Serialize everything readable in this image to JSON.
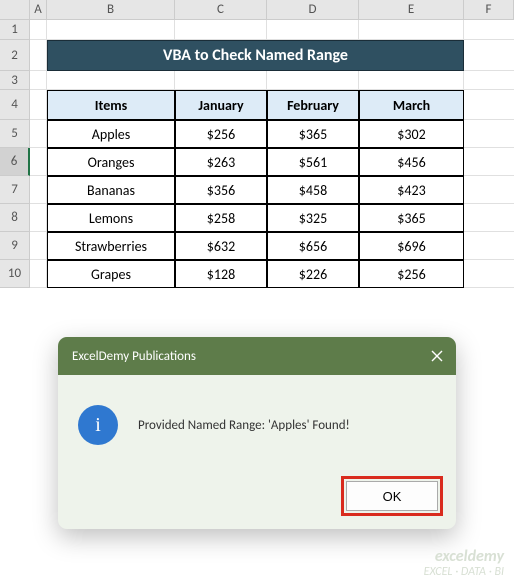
{
  "columns": [
    "A",
    "B",
    "C",
    "D",
    "E",
    "F"
  ],
  "rows": [
    "1",
    "2",
    "3",
    "4",
    "5",
    "6",
    "7",
    "8",
    "9",
    "10"
  ],
  "title": "VBA to Check Named Range",
  "headers": {
    "items": "Items",
    "jan": "January",
    "feb": "February",
    "mar": "March"
  },
  "data": [
    {
      "item": "Apples",
      "jan": "$256",
      "feb": "$365",
      "mar": "$302"
    },
    {
      "item": "Oranges",
      "jan": "$263",
      "feb": "$561",
      "mar": "$456"
    },
    {
      "item": "Bananas",
      "jan": "$356",
      "feb": "$458",
      "mar": "$423"
    },
    {
      "item": "Lemons",
      "jan": "$258",
      "feb": "$325",
      "mar": "$365"
    },
    {
      "item": "Strawberries",
      "jan": "$632",
      "feb": "$656",
      "mar": "$696"
    },
    {
      "item": "Grapes",
      "jan": "$128",
      "feb": "$226",
      "mar": "$256"
    }
  ],
  "dialog": {
    "title": "ExcelDemy Publications",
    "msg": "Provided Named Range: 'Apples' Found!",
    "ok": "OK",
    "info_glyph": "i"
  },
  "watermark": {
    "line1": "exceldemy",
    "line2": "EXCEL · DATA · BI"
  },
  "chart_data": {
    "type": "table",
    "categories": [
      "Items",
      "January",
      "February",
      "March"
    ],
    "series": [
      {
        "name": "Apples",
        "values": [
          256,
          365,
          302
        ]
      },
      {
        "name": "Oranges",
        "values": [
          263,
          561,
          456
        ]
      },
      {
        "name": "Bananas",
        "values": [
          356,
          458,
          423
        ]
      },
      {
        "name": "Lemons",
        "values": [
          258,
          325,
          365
        ]
      },
      {
        "name": "Strawberries",
        "values": [
          632,
          656,
          696
        ]
      },
      {
        "name": "Grapes",
        "values": [
          128,
          226,
          256
        ]
      }
    ],
    "title": "VBA to Check Named Range"
  }
}
